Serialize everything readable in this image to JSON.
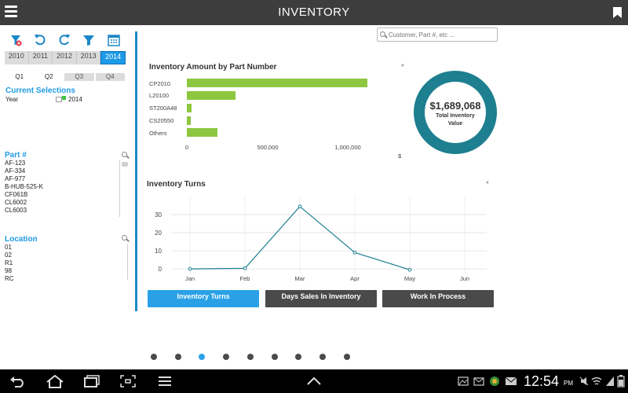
{
  "app": {
    "title": "INVENTORY"
  },
  "filters": {
    "years": [
      "2010",
      "2011",
      "2012",
      "2013",
      "2014"
    ],
    "selected_year": "2014",
    "quarters": [
      "Q1",
      "Q2",
      "Q3",
      "Q4"
    ]
  },
  "current_selections": {
    "title": "Current Selections",
    "field": "Year",
    "value": "2014"
  },
  "part_list": {
    "title": "Part #",
    "items": [
      "AF-123",
      "AF-334",
      "AF-977",
      "B-HUB-525-K",
      "CF061B",
      "CL6002",
      "CL6003"
    ]
  },
  "location_list": {
    "title": "Location",
    "items": [
      "01",
      "02",
      "R1",
      "98",
      "RC"
    ]
  },
  "search": {
    "placeholder": "Customer, Part #, etc ..."
  },
  "bar_panel": {
    "expand": "››",
    "unit": "$"
  },
  "donut": {
    "value": "$1,689,068",
    "label_line1": "Total Inventory",
    "label_line2": "Value"
  },
  "line_panel": {
    "expand": "››"
  },
  "chart_data": [
    {
      "type": "bar",
      "orientation": "horizontal",
      "title": "Inventory Amount by Part Number",
      "categories": [
        "CP2010",
        "L20100",
        "ST200A48",
        "CS20550",
        "Others"
      ],
      "values": [
        1120000,
        300000,
        30000,
        25000,
        190000
      ],
      "xticks": [
        "0",
        "500,000",
        "1,000,000"
      ],
      "xlim": [
        0,
        1170000
      ],
      "color": "#8dc63f"
    },
    {
      "type": "line",
      "title": "Inventory Turns",
      "categories": [
        "Jan",
        "Feb",
        "Mar",
        "Apr",
        "May",
        "Jun"
      ],
      "values": [
        0,
        0.3,
        34.5,
        9,
        -0.5,
        null
      ],
      "yticks": [
        "30",
        "20",
        "10",
        "0"
      ],
      "ylim": [
        -3,
        40
      ],
      "grid": true,
      "color": "#1d7f8f"
    }
  ],
  "tabs": [
    "Inventory Turns",
    "Days Sales In Inventory",
    "Work In Process"
  ],
  "active_tab": 0,
  "pager": {
    "count": 9,
    "active": 2
  },
  "statusbar": {
    "time": "12:54",
    "ampm": "PM"
  }
}
